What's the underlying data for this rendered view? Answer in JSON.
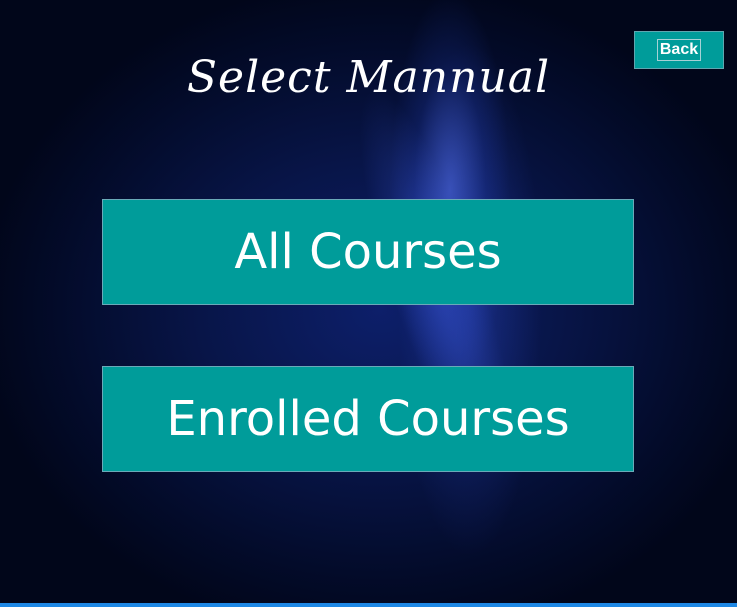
{
  "title": "Select Mannual",
  "back_label": "Back",
  "buttons": {
    "all_courses": "All Courses",
    "enrolled_courses": "Enrolled Courses"
  },
  "colors": {
    "button": "#009c9a",
    "background": "#020a24",
    "accent_line": "#1e88e5"
  }
}
